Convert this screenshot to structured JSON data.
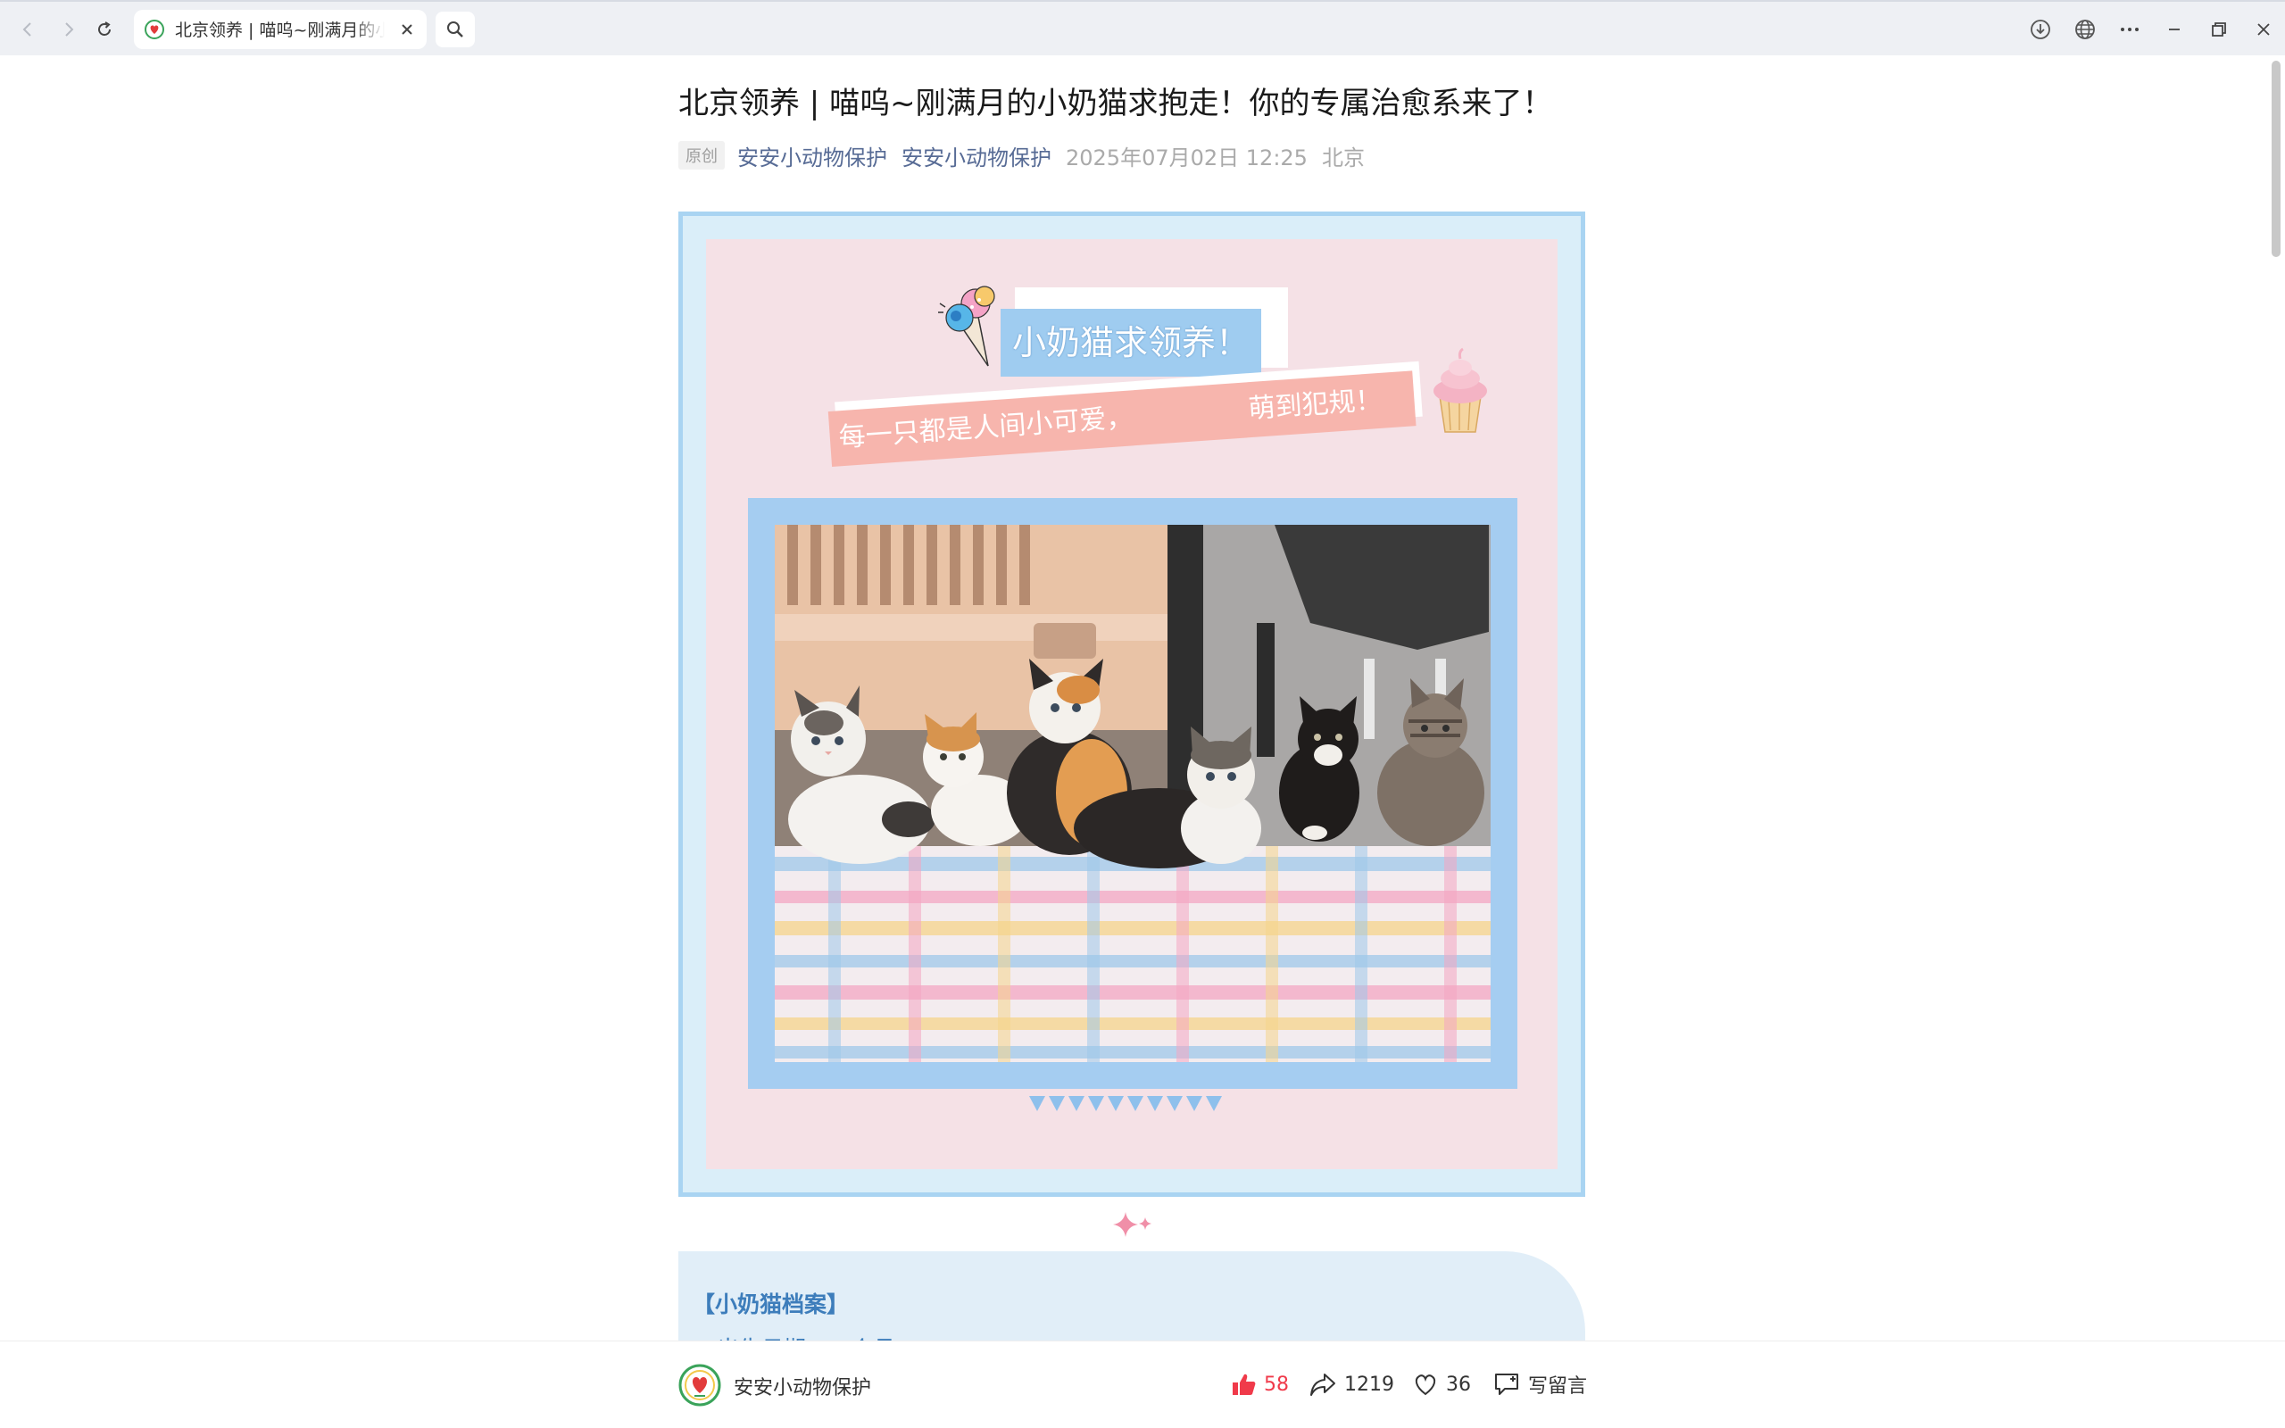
{
  "browser": {
    "tab_title": "北京领养 | 喵呜~刚满月的小奶猫求抱走！你的专属治愈系来了！"
  },
  "article": {
    "title": "北京领养 | 喵呜~刚满月的小奶猫求抱走！你的专属治愈系来了！",
    "original_tag": "原创",
    "author_1": "安安小动物保护",
    "author_2": "安安小动物保护",
    "date": "2025年07月02日 12:25",
    "location": "北京"
  },
  "poster": {
    "banner": "小奶猫求领养！",
    "ribbon_left": "每一只都是人间小可爱，",
    "ribbon_right": "萌到犯规！",
    "colors": {
      "frame": "#a9d4f2",
      "inner": "#f5e1e6",
      "banner": "#9fccf0",
      "ribbon": "#f7b5ad"
    }
  },
  "profile": {
    "heading": "【小奶猫档案】",
    "line_1": "◆ 出生日期：一个月"
  },
  "bottom_bar": {
    "account_name": "安安小动物保护",
    "likes": "58",
    "shares": "1219",
    "favorites": "36",
    "comment_label": "写留言"
  },
  "icons": [
    "back-icon",
    "forward-icon",
    "reload-icon",
    "search-icon",
    "download-icon",
    "globe-icon",
    "more-icon",
    "minimize-icon",
    "restore-icon",
    "close-icon",
    "like-icon",
    "share-icon",
    "heart-icon",
    "comment-icon"
  ]
}
